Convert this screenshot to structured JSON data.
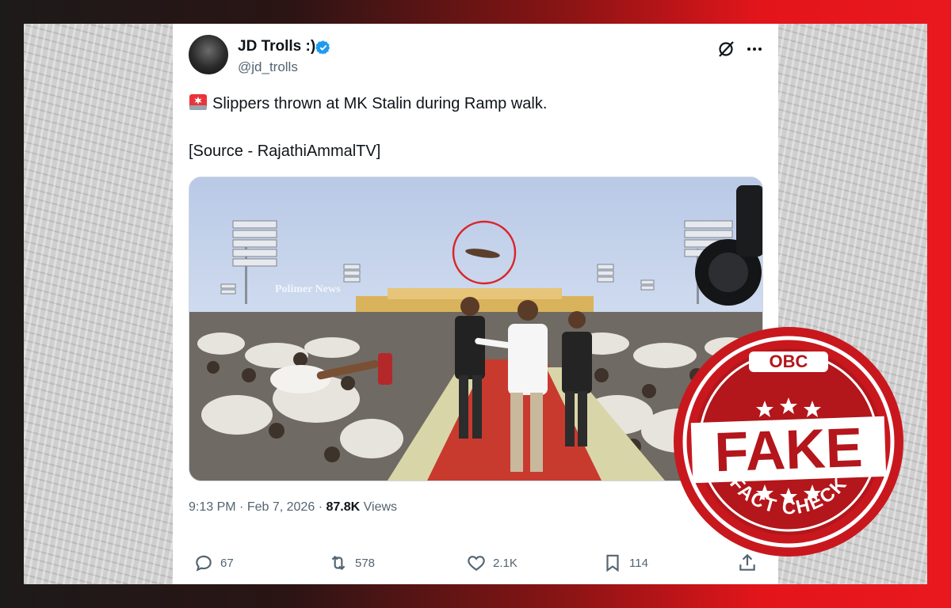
{
  "post": {
    "author_name": "JD Trolls :)",
    "author_handle": "@jd_trolls",
    "text": "Slippers thrown at MK Stalin during Ramp walk.",
    "source": "[Source - RajathiAmmalTV]",
    "media_watermark": "Polimer News",
    "time": "9:13 PM",
    "date": "Feb 7, 2026",
    "views_count": "87.8K",
    "views_label": "Views"
  },
  "actions": {
    "replies": "67",
    "reposts": "578",
    "likes": "2.1K",
    "bookmarks": "114"
  },
  "stamp": {
    "top_text": "OBC",
    "main_text": "FAKE",
    "bottom_text": "FACT CHECK"
  },
  "colors": {
    "verified": "#1d9bf0",
    "stamp_red": "#c8181e",
    "highlight_circle": "#d9262c"
  },
  "icons": [
    "siren-emoji-icon",
    "verified-icon",
    "grok-icon",
    "more-icon",
    "reply-icon",
    "repost-icon",
    "like-icon",
    "bookmark-icon",
    "share-icon"
  ]
}
